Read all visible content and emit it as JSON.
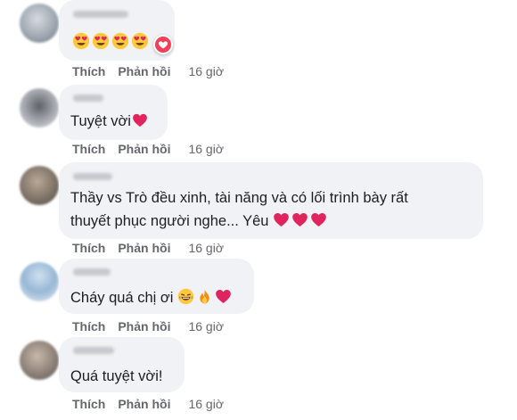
{
  "comments": [
    {
      "text": "",
      "emojis": [
        "heart-eyes",
        "heart-eyes",
        "heart-eyes",
        "heart-eyes"
      ],
      "like_label": "Thích",
      "reply_label": "Phản hồi",
      "time": "16 giờ"
    },
    {
      "text": "Tuyệt vời",
      "emojis": [
        "red-heart"
      ],
      "like_label": "Thích",
      "reply_label": "Phản hồi",
      "time": "16 giờ"
    },
    {
      "text_line1": "Thầy vs Trò đều xinh, tài năng và có lối trình bày rất",
      "text_line2": "thuyết phục người nghe... Yêu",
      "emojis": [
        "red-heart",
        "red-heart",
        "red-heart"
      ],
      "like_label": "Thích",
      "reply_label": "Phản hồi",
      "time": "16 giờ"
    },
    {
      "text": "Cháy quá chị ơi",
      "emojis": [
        "laughing-tears",
        "fire",
        "red-heart"
      ],
      "like_label": "Thích",
      "reply_label": "Phản hồi",
      "time": "16 giờ"
    },
    {
      "text": "Quá tuyệt vời!",
      "like_label": "Thích",
      "reply_label": "Phản hồi",
      "time": "16 giờ"
    }
  ],
  "colors": {
    "bubble": "#f0f2f5",
    "meta": "#65676b",
    "text": "#1c1e21",
    "love": "#f33e58"
  },
  "icons": {
    "reaction": "love-reaction-icon"
  }
}
